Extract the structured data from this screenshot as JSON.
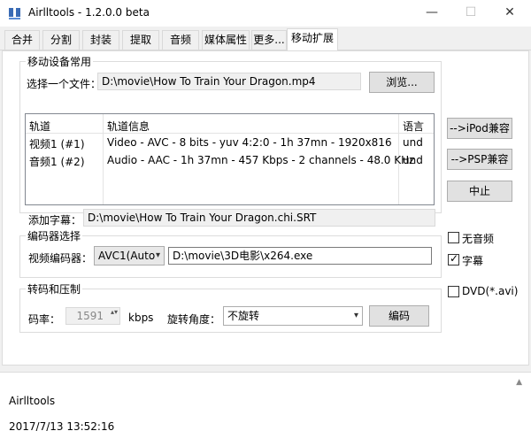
{
  "window": {
    "title": "Airlltools  -  1.2.0.0 beta",
    "minimize_glyph": "—",
    "maximize_glyph": "☐",
    "close_glyph": "✕"
  },
  "tabs": [
    {
      "label": "合并",
      "active": false
    },
    {
      "label": "分割",
      "active": false
    },
    {
      "label": "封装",
      "active": false
    },
    {
      "label": "提取",
      "active": false
    },
    {
      "label": "音频",
      "active": false
    },
    {
      "label": "媒体属性",
      "active": false
    },
    {
      "label": "更多...",
      "active": false
    },
    {
      "label": "移动扩展",
      "active": true
    }
  ],
  "mobile": {
    "group_title": "移动设备常用",
    "select_file_label": "选择一个文件：",
    "file_path": "D:\\movie\\How To Train Your Dragon.mp4",
    "browse_button": "浏览..."
  },
  "tracks": {
    "headers": [
      "轨道",
      "轨道信息",
      "语言"
    ],
    "rows": [
      {
        "track": "视频1 (#1)",
        "info": "Video - AVC - 8 bits - yuv 4:2:0 - 1h 37mn - 1920x816",
        "lang": "und"
      },
      {
        "track": "音频1 (#2)",
        "info": "Audio - AAC - 1h 37mn - 457 Kbps - 2 channels - 48.0 KHz",
        "lang": "und"
      }
    ]
  },
  "side_buttons": {
    "ipod": "-->iPod兼容",
    "psp": "-->PSP兼容",
    "stop": "中止"
  },
  "subtitle": {
    "label": "添加字幕：",
    "path": "D:\\movie\\How To Train Your Dragon.chi.SRT"
  },
  "encoder": {
    "group_title": "编码器选择",
    "video_encoder_label": "视频编码器：",
    "encoder_value": "AVC1(Auto",
    "encoder_path": "D:\\movie\\3D电影\\x264.exe"
  },
  "checkboxes": {
    "no_audio": {
      "label": "无音频",
      "checked": false,
      "mark": ""
    },
    "subtitles": {
      "label": "字幕",
      "checked": true,
      "mark": "✓"
    },
    "dvd": {
      "label": "DVD(*.avi)",
      "checked": false,
      "mark": ""
    }
  },
  "transcode": {
    "group_title": "转码和压制",
    "bitrate_label": "码率：",
    "bitrate_value": "1591",
    "bitrate_unit": "kbps",
    "rotation_label": "旋转角度：",
    "rotation_value": "不旋转",
    "encode_button": "编码"
  },
  "log": {
    "app_name": "Airlltools",
    "timestamp": "2017/7/13 13:52:16"
  },
  "icons": {
    "app": "app-logo-icon",
    "chevron": "▾",
    "spinner": "▴▾"
  }
}
